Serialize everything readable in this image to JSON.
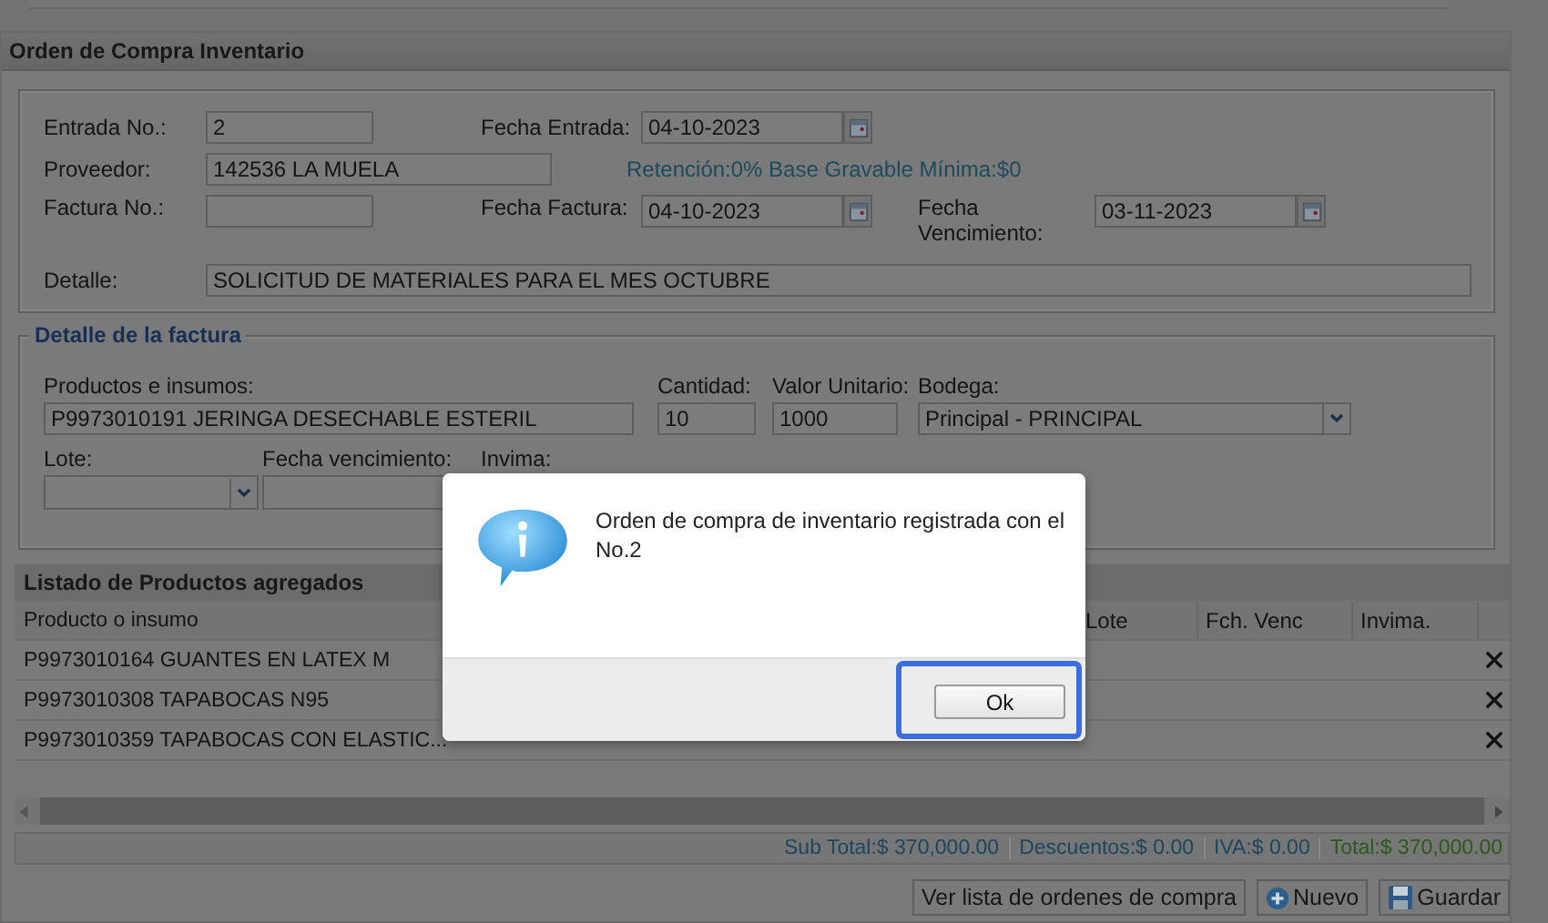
{
  "panel": {
    "title": "Orden de Compra Inventario"
  },
  "header_form": {
    "entrada_no": {
      "label": "Entrada No.:",
      "value": "2"
    },
    "fecha_entrada": {
      "label": "Fecha Entrada:",
      "value": "04-10-2023"
    },
    "proveedor": {
      "label": "Proveedor:",
      "value": "142536 LA MUELA"
    },
    "retencion": "Retención:0% Base Gravable Mínima:$0",
    "factura_no": {
      "label": "Factura No.:"
    },
    "fecha_factura": {
      "label": "Fecha Factura:",
      "value": "04-10-2023"
    },
    "fecha_vencimiento": {
      "label": "Fecha Vencimiento:",
      "value": "03-11-2023"
    },
    "detalle": {
      "label": "Detalle:",
      "value": "SOLICITUD DE MATERIALES PARA EL MES OCTUBRE"
    }
  },
  "invoice_detail": {
    "legend": "Detalle de la factura",
    "productos": {
      "label": "Productos e insumos:",
      "value": "P9973010191 JERINGA DESECHABLE ESTERIL"
    },
    "cantidad": {
      "label": "Cantidad:",
      "value": "10"
    },
    "valor_unitario": {
      "label": "Valor Unitario:",
      "value": "1000"
    },
    "bodega": {
      "label": "Bodega:",
      "value": "Principal - PRINCIPAL"
    },
    "lote": {
      "label": "Lote:"
    },
    "fecha_vencimiento": {
      "label": "Fecha vencimiento:"
    },
    "invima": {
      "label": "Invima:"
    }
  },
  "products_list": {
    "title": "Listado de Productos agregados",
    "columns": [
      "Producto o insumo",
      "Lote",
      "Fch. Venc",
      "Invima."
    ],
    "rows": [
      {
        "product": "P9973010164 GUANTES EN LATEX M"
      },
      {
        "product": "P9973010308 TAPABOCAS N95"
      },
      {
        "product": "P9973010359 TAPABOCAS CON ELASTIC..."
      }
    ]
  },
  "totals": [
    {
      "kind": "normal",
      "text": "Sub Total:$ 370,000.00"
    },
    {
      "kind": "normal",
      "text": "Descuentos:$ 0.00"
    },
    {
      "kind": "normal",
      "text": "IVA:$ 0.00"
    },
    {
      "kind": "total",
      "text": "Total:$ 370,000.00"
    }
  ],
  "buttons": [
    {
      "kind": "plain",
      "label": "Ver lista de ordenes de compra"
    },
    {
      "kind": "new",
      "label": "Nuevo"
    },
    {
      "kind": "save",
      "label": "Guardar"
    }
  ],
  "dialog": {
    "message": "Orden de compra de inventario registrada con el No.2",
    "button": "Ok"
  }
}
